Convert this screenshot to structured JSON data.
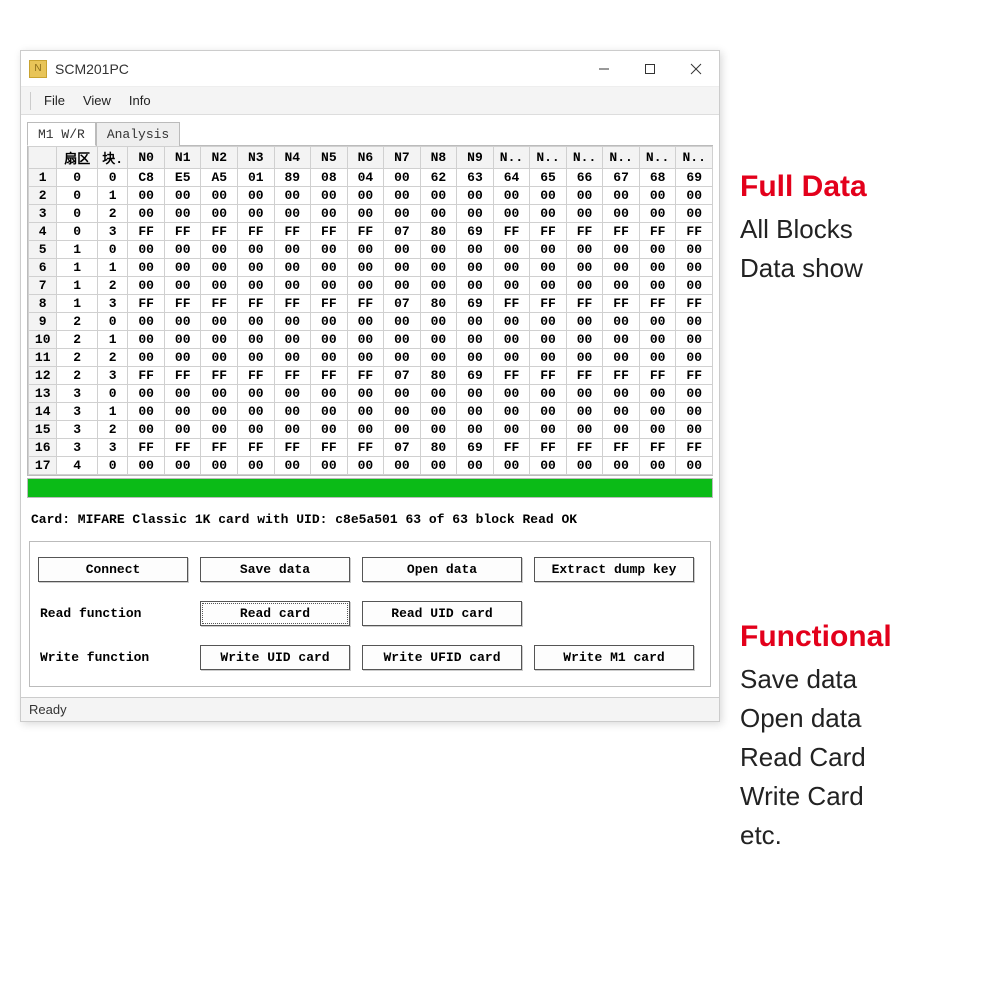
{
  "window": {
    "title": "SCM201PC",
    "icon_glyph": "N"
  },
  "menu": {
    "file": "File",
    "view": "View",
    "info": "Info"
  },
  "tabs": {
    "wr": "M1 W/R",
    "analysis": "Analysis"
  },
  "grid": {
    "headers": [
      "",
      "扇区",
      "块.",
      "N0",
      "N1",
      "N2",
      "N3",
      "N4",
      "N5",
      "N6",
      "N7",
      "N8",
      "N9",
      "N..",
      "N..",
      "N..",
      "N..",
      "N..",
      "N.."
    ],
    "rows": [
      {
        "n": "1",
        "sec": "0",
        "blk": "0",
        "d": [
          "C8",
          "E5",
          "A5",
          "01",
          "89",
          "08",
          "04",
          "00",
          "62",
          "63",
          "64",
          "65",
          "66",
          "67",
          "68",
          "69"
        ]
      },
      {
        "n": "2",
        "sec": "0",
        "blk": "1",
        "d": [
          "00",
          "00",
          "00",
          "00",
          "00",
          "00",
          "00",
          "00",
          "00",
          "00",
          "00",
          "00",
          "00",
          "00",
          "00",
          "00"
        ]
      },
      {
        "n": "3",
        "sec": "0",
        "blk": "2",
        "d": [
          "00",
          "00",
          "00",
          "00",
          "00",
          "00",
          "00",
          "00",
          "00",
          "00",
          "00",
          "00",
          "00",
          "00",
          "00",
          "00"
        ]
      },
      {
        "n": "4",
        "sec": "0",
        "blk": "3",
        "d": [
          "FF",
          "FF",
          "FF",
          "FF",
          "FF",
          "FF",
          "FF",
          "07",
          "80",
          "69",
          "FF",
          "FF",
          "FF",
          "FF",
          "FF",
          "FF"
        ]
      },
      {
        "n": "5",
        "sec": "1",
        "blk": "0",
        "d": [
          "00",
          "00",
          "00",
          "00",
          "00",
          "00",
          "00",
          "00",
          "00",
          "00",
          "00",
          "00",
          "00",
          "00",
          "00",
          "00"
        ]
      },
      {
        "n": "6",
        "sec": "1",
        "blk": "1",
        "d": [
          "00",
          "00",
          "00",
          "00",
          "00",
          "00",
          "00",
          "00",
          "00",
          "00",
          "00",
          "00",
          "00",
          "00",
          "00",
          "00"
        ]
      },
      {
        "n": "7",
        "sec": "1",
        "blk": "2",
        "d": [
          "00",
          "00",
          "00",
          "00",
          "00",
          "00",
          "00",
          "00",
          "00",
          "00",
          "00",
          "00",
          "00",
          "00",
          "00",
          "00"
        ]
      },
      {
        "n": "8",
        "sec": "1",
        "blk": "3",
        "d": [
          "FF",
          "FF",
          "FF",
          "FF",
          "FF",
          "FF",
          "FF",
          "07",
          "80",
          "69",
          "FF",
          "FF",
          "FF",
          "FF",
          "FF",
          "FF"
        ]
      },
      {
        "n": "9",
        "sec": "2",
        "blk": "0",
        "d": [
          "00",
          "00",
          "00",
          "00",
          "00",
          "00",
          "00",
          "00",
          "00",
          "00",
          "00",
          "00",
          "00",
          "00",
          "00",
          "00"
        ]
      },
      {
        "n": "10",
        "sec": "2",
        "blk": "1",
        "d": [
          "00",
          "00",
          "00",
          "00",
          "00",
          "00",
          "00",
          "00",
          "00",
          "00",
          "00",
          "00",
          "00",
          "00",
          "00",
          "00"
        ]
      },
      {
        "n": "11",
        "sec": "2",
        "blk": "2",
        "d": [
          "00",
          "00",
          "00",
          "00",
          "00",
          "00",
          "00",
          "00",
          "00",
          "00",
          "00",
          "00",
          "00",
          "00",
          "00",
          "00"
        ]
      },
      {
        "n": "12",
        "sec": "2",
        "blk": "3",
        "d": [
          "FF",
          "FF",
          "FF",
          "FF",
          "FF",
          "FF",
          "FF",
          "07",
          "80",
          "69",
          "FF",
          "FF",
          "FF",
          "FF",
          "FF",
          "FF"
        ]
      },
      {
        "n": "13",
        "sec": "3",
        "blk": "0",
        "d": [
          "00",
          "00",
          "00",
          "00",
          "00",
          "00",
          "00",
          "00",
          "00",
          "00",
          "00",
          "00",
          "00",
          "00",
          "00",
          "00"
        ]
      },
      {
        "n": "14",
        "sec": "3",
        "blk": "1",
        "d": [
          "00",
          "00",
          "00",
          "00",
          "00",
          "00",
          "00",
          "00",
          "00",
          "00",
          "00",
          "00",
          "00",
          "00",
          "00",
          "00"
        ]
      },
      {
        "n": "15",
        "sec": "3",
        "blk": "2",
        "d": [
          "00",
          "00",
          "00",
          "00",
          "00",
          "00",
          "00",
          "00",
          "00",
          "00",
          "00",
          "00",
          "00",
          "00",
          "00",
          "00"
        ]
      },
      {
        "n": "16",
        "sec": "3",
        "blk": "3",
        "d": [
          "FF",
          "FF",
          "FF",
          "FF",
          "FF",
          "FF",
          "FF",
          "07",
          "80",
          "69",
          "FF",
          "FF",
          "FF",
          "FF",
          "FF",
          "FF"
        ]
      },
      {
        "n": "17",
        "sec": "4",
        "blk": "0",
        "d": [
          "00",
          "00",
          "00",
          "00",
          "00",
          "00",
          "00",
          "00",
          "00",
          "00",
          "00",
          "00",
          "00",
          "00",
          "00",
          "00"
        ]
      }
    ]
  },
  "status_under": "Card: MIFARE Classic 1K card with UID: c8e5a501 63 of 63 block Read OK",
  "buttons": {
    "connect": "Connect",
    "save_data": "Save data",
    "open_data": "Open data",
    "extract": "Extract dump key",
    "read_label": "Read function",
    "read_card": "Read card",
    "read_uid": "Read UID card",
    "write_label": "Write function",
    "write_uid": "Write UID card",
    "write_ufid": "Write UFID card",
    "write_m1": "Write M1 card"
  },
  "statusbar": "Ready",
  "annotations": {
    "full_title": "Full Data",
    "full_l1": "All Blocks",
    "full_l2": "Data show",
    "func_title": "Functional",
    "func_l1": "Save data",
    "func_l2": "Open data",
    "func_l3": "Read Card",
    "func_l4": "Write Card",
    "func_l5": "etc."
  }
}
